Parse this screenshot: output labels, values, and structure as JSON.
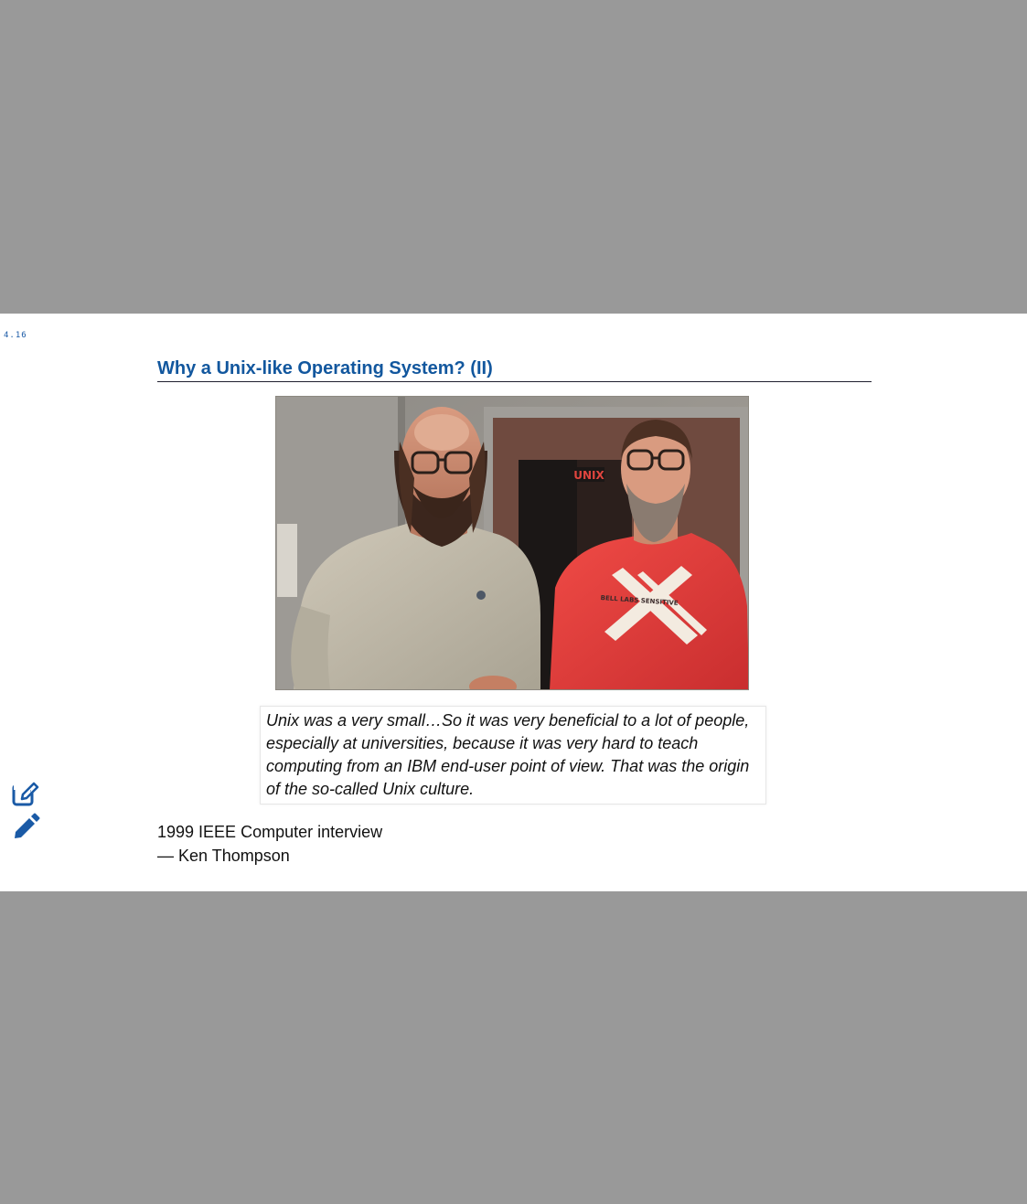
{
  "slide": {
    "number": "4.16",
    "title": "Why a Unix-like Operating System? (II)"
  },
  "photo": {
    "sign_text": "UNIX",
    "shirt_text": "BELL LABS SENSITIVE"
  },
  "quote": {
    "text": "Unix was a very small…So it was very beneficial to a lot of people, especially at universities, because it was very hard to teach computing from an IBM end-user point of view. That was the origin of the so-called Unix culture."
  },
  "citation": {
    "source": "1999 IEEE Computer interview",
    "author": "— Ken Thompson"
  },
  "tools": {
    "annotate_icon": "edit-square-icon",
    "pen_icon": "pencil-icon"
  },
  "colors": {
    "accent": "#12579e",
    "backdrop": "#999999"
  }
}
